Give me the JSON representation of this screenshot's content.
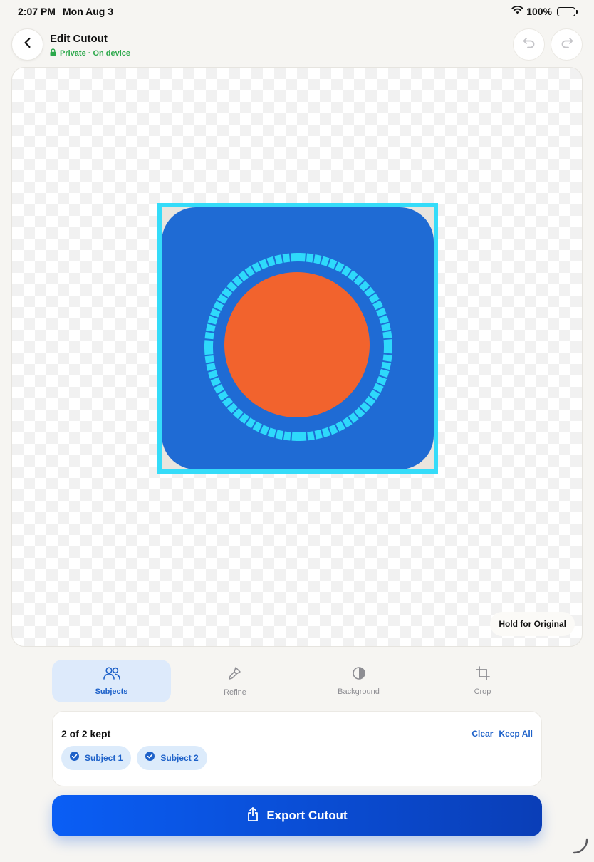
{
  "status_bar": {
    "time": "2:07 PM",
    "date": "Mon Aug 3",
    "battery": "100%"
  },
  "header": {
    "title": "Edit Cutout",
    "subtitle": "Private · On device"
  },
  "canvas": {
    "hold_button": "Hold for Original"
  },
  "tabs": [
    {
      "label": "Subjects",
      "icon": "people-icon",
      "active": true
    },
    {
      "label": "Refine",
      "icon": "brush-icon",
      "active": false
    },
    {
      "label": "Background",
      "icon": "half-circle-icon",
      "active": false
    },
    {
      "label": "Crop",
      "icon": "crop-icon",
      "active": false
    }
  ],
  "subjects_panel": {
    "summary": "2 of 2 kept",
    "clear_label": "Clear",
    "keep_all_label": "Keep All",
    "subjects": [
      {
        "label": "Subject 1",
        "checked": true
      },
      {
        "label": "Subject 2",
        "checked": true
      }
    ]
  },
  "export_button": {
    "label": "Export Cutout"
  },
  "colors": {
    "accent": "#1d61c9",
    "selection_outline": "#35dcf9",
    "cutout_background": "#1f6bd4",
    "cutout_circle": "#f2632d",
    "private_green": "#2ba84a"
  }
}
